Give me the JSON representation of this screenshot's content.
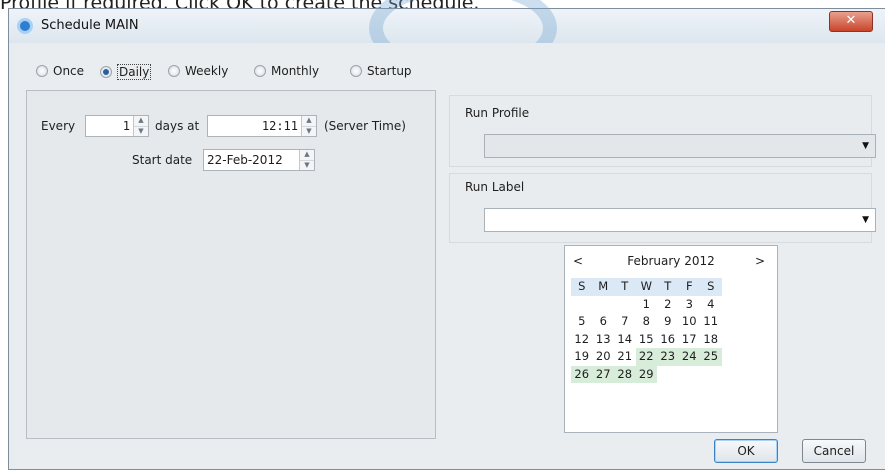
{
  "caption": "Profile if required. Click OK to create the schedule.",
  "window": {
    "title": "Schedule MAIN",
    "close_glyph": "✕"
  },
  "frequency": {
    "options": [
      "Once",
      "Daily",
      "Weekly",
      "Monthly",
      "Startup"
    ],
    "selected": "Daily"
  },
  "schedule": {
    "every_label": "Every",
    "every_value": "1",
    "days_at_label": "days at",
    "time_value": "12:11",
    "server_time_label": "(Server Time)",
    "start_date_label": "Start date",
    "start_date_value": "22-Feb-2012"
  },
  "run_profile": {
    "label": "Run Profile",
    "value": "",
    "disabled": true
  },
  "run_label": {
    "label": "Run Label",
    "value": ""
  },
  "calendar": {
    "prev": "<",
    "next": ">",
    "month_label": "February 2012",
    "weekdays": [
      "S",
      "M",
      "T",
      "W",
      "T",
      "F",
      "S"
    ],
    "weeks": [
      [
        "",
        "",
        "",
        "1",
        "2",
        "3",
        "4"
      ],
      [
        "5",
        "6",
        "7",
        "8",
        "9",
        "10",
        "11"
      ],
      [
        "12",
        "13",
        "14",
        "15",
        "16",
        "17",
        "18"
      ],
      [
        "19",
        "20",
        "21",
        "22",
        "23",
        "24",
        "25"
      ],
      [
        "26",
        "27",
        "28",
        "29",
        "",
        "",
        ""
      ]
    ],
    "highlighted_days": [
      "22",
      "23",
      "24",
      "25",
      "26",
      "27",
      "28",
      "29"
    ],
    "highlight_color": "#d7ecd9"
  },
  "buttons": {
    "ok": "OK",
    "cancel": "Cancel"
  },
  "colors": {
    "accent": "#2a5fa5",
    "close_button": "#c9452b"
  },
  "icons": {
    "spinner_up": "▲",
    "spinner_down": "▼",
    "dropdown": "▼"
  }
}
